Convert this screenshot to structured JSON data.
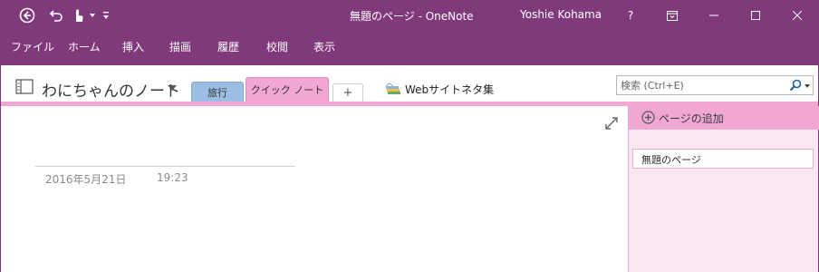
{
  "window": {
    "title": "無題のページ - OneNote",
    "user": "Yoshie Kohama",
    "help_label": "?",
    "accent": "#80397b"
  },
  "quick_access": {
    "back_icon": "back-circle-icon",
    "undo_icon": "undo-icon",
    "touch_icon": "touch-mode-icon",
    "customize_icon": "customize-qat-icon"
  },
  "ribbon": {
    "tabs": [
      "ファイル",
      "ホーム",
      "挿入",
      "描画",
      "履歴",
      "校閲",
      "表示"
    ]
  },
  "notebook": {
    "name": "わにちゃんのノート",
    "sections": [
      {
        "label": "旅行",
        "color": "#9cbde4"
      },
      {
        "label": "クイック ノート",
        "color": "#f0a8d3"
      }
    ],
    "add_section_label": "+",
    "web_group_label": "Webサイトネタ集"
  },
  "search": {
    "placeholder": "検索 (Ctrl+E)"
  },
  "page": {
    "date": "2016年5月21日",
    "time": "19:23"
  },
  "pages_pane": {
    "add_page_label": "ページの追加",
    "pages": [
      "無題のページ"
    ],
    "background": "#fbe6f1"
  }
}
